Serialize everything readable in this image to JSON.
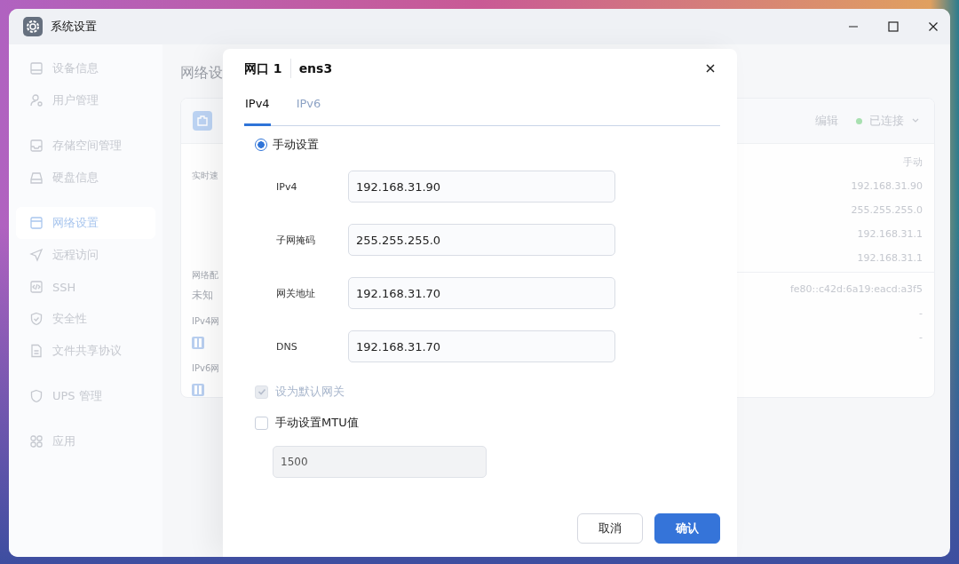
{
  "window": {
    "title": "系统设置"
  },
  "sidebar": {
    "groups": [
      {
        "items": [
          {
            "label": "设备信息",
            "selected": false
          },
          {
            "label": "用户管理",
            "selected": false
          }
        ]
      },
      {
        "items": [
          {
            "label": "存储空间管理",
            "selected": false
          },
          {
            "label": "硬盘信息",
            "selected": false
          }
        ]
      },
      {
        "items": [
          {
            "label": "网络设置",
            "selected": true
          },
          {
            "label": "远程访问",
            "selected": false
          },
          {
            "label": "SSH",
            "selected": false
          },
          {
            "label": "安全性",
            "selected": false
          },
          {
            "label": "文件共享协议",
            "selected": false
          }
        ]
      },
      {
        "items": [
          {
            "label": "UPS 管理",
            "selected": false
          }
        ]
      },
      {
        "items": [
          {
            "label": "应用",
            "selected": false
          }
        ]
      }
    ]
  },
  "page": {
    "heading": "网络设",
    "card": {
      "edit": "编辑",
      "status": "已连接",
      "left": [
        {
          "kind": "label",
          "text": "实时速"
        },
        {
          "kind": "label",
          "text": "网络配"
        },
        {
          "kind": "value",
          "text": "未知"
        },
        {
          "kind": "label",
          "text": "IPv4网"
        },
        {
          "kind": "icon"
        },
        {
          "kind": "label",
          "text": "IPv6网"
        },
        {
          "kind": "icon"
        }
      ],
      "values": [
        "手动",
        "192.168.31.90",
        "255.255.255.0",
        "192.168.31.1",
        "192.168.31.1"
      ],
      "ipv6_values": [
        "fe80::c42d:6a19:eacd:a3f5",
        "-",
        "-"
      ]
    }
  },
  "dialog": {
    "title": "网口 1",
    "subtitle": "ens3",
    "tabs": [
      {
        "label": "IPv4",
        "selected": true
      },
      {
        "label": "IPv6",
        "selected": false
      }
    ],
    "mode": {
      "label": "手动设置",
      "selected": true
    },
    "fields": [
      {
        "label": "IPv4",
        "value": "192.168.31.90"
      },
      {
        "label": "子网掩码",
        "value": "255.255.255.0"
      },
      {
        "label": "网关地址",
        "value": "192.168.31.70"
      },
      {
        "label": "DNS",
        "value": "192.168.31.70"
      }
    ],
    "options": [
      {
        "label": "设为默认网关",
        "checked": true,
        "disabled": true
      },
      {
        "label": "手动设置MTU值",
        "checked": false,
        "disabled": false
      }
    ],
    "mtu": {
      "value": "1500",
      "disabled": true
    },
    "buttons": [
      {
        "label": "取消",
        "kind": "secondary"
      },
      {
        "label": "确认",
        "kind": "primary"
      }
    ]
  }
}
